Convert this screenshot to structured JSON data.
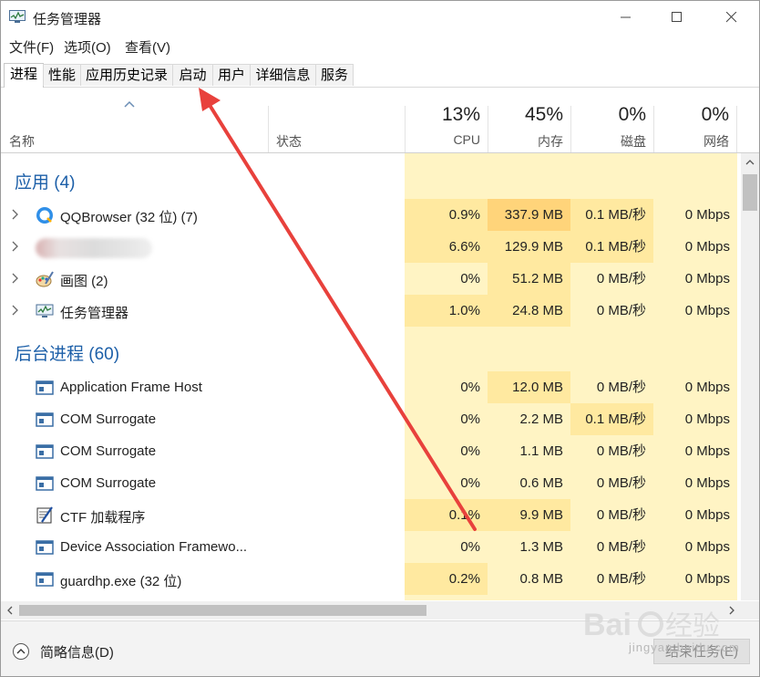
{
  "window": {
    "title": "任务管理器",
    "controls": [
      "minimize-icon",
      "maximize-icon",
      "close-icon"
    ]
  },
  "menu": [
    "文件(F)",
    "选项(O)",
    "查看(V)"
  ],
  "tabs": [
    "进程",
    "性能",
    "应用历史记录",
    "启动",
    "用户",
    "详细信息",
    "服务"
  ],
  "active_tab": "进程",
  "columns": {
    "name": "名称",
    "status": "状态",
    "cpu": {
      "percent": "13%",
      "label": "CPU"
    },
    "memory": {
      "percent": "45%",
      "label": "内存"
    },
    "disk": {
      "percent": "0%",
      "label": "磁盘"
    },
    "network": {
      "percent": "0%",
      "label": "网络"
    }
  },
  "groups": {
    "apps": {
      "title": "应用 (4)",
      "rows": [
        {
          "name": "QQBrowser (32 位) (7)",
          "icon": "qqbrowser-icon",
          "cpu": "0.9%",
          "mem": "337.9 MB",
          "disk": "0.1 MB/秒",
          "net": "0 Mbps"
        },
        {
          "name": "",
          "icon": "blurred-app-icon",
          "cpu": "6.6%",
          "mem": "129.9 MB",
          "disk": "0.1 MB/秒",
          "net": "0 Mbps"
        },
        {
          "name": "画图 (2)",
          "icon": "paint-icon",
          "cpu": "0%",
          "mem": "51.2 MB",
          "disk": "0 MB/秒",
          "net": "0 Mbps"
        },
        {
          "name": "任务管理器",
          "icon": "task-manager-icon",
          "cpu": "1.0%",
          "mem": "24.8 MB",
          "disk": "0 MB/秒",
          "net": "0 Mbps"
        }
      ]
    },
    "background": {
      "title": "后台进程 (60)",
      "rows": [
        {
          "name": "Application Frame Host",
          "icon": "process-window-icon",
          "cpu": "0%",
          "mem": "12.0 MB",
          "disk": "0 MB/秒",
          "net": "0 Mbps"
        },
        {
          "name": "COM Surrogate",
          "icon": "process-window-icon",
          "cpu": "0%",
          "mem": "2.2 MB",
          "disk": "0.1 MB/秒",
          "net": "0 Mbps"
        },
        {
          "name": "COM Surrogate",
          "icon": "process-window-icon",
          "cpu": "0%",
          "mem": "1.1 MB",
          "disk": "0 MB/秒",
          "net": "0 Mbps"
        },
        {
          "name": "COM Surrogate",
          "icon": "process-window-icon",
          "cpu": "0%",
          "mem": "0.6 MB",
          "disk": "0 MB/秒",
          "net": "0 Mbps"
        },
        {
          "name": "CTF 加载程序",
          "icon": "ctf-loader-icon",
          "cpu": "0.1%",
          "mem": "9.9 MB",
          "disk": "0 MB/秒",
          "net": "0 Mbps"
        },
        {
          "name": "Device Association Framewo...",
          "icon": "process-window-icon",
          "cpu": "0%",
          "mem": "1.3 MB",
          "disk": "0 MB/秒",
          "net": "0 Mbps"
        },
        {
          "name": "guardhp.exe (32 位)",
          "icon": "process-window-icon",
          "cpu": "0.2%",
          "mem": "0.8 MB",
          "disk": "0 MB/秒",
          "net": "0 Mbps"
        }
      ]
    }
  },
  "footer": {
    "fewer_details": "简略信息(D)",
    "end_task": "结束任务(E)"
  },
  "colors": {
    "heat_light": "#fff4c4",
    "heat_medium": "#ffe9a0",
    "heat_strong": "#ffd47a",
    "group_title": "#1c5fa8",
    "annotation_arrow": "#e8413c"
  },
  "watermark": {
    "brand": "Baidu经验",
    "url": "jingyan.baidu.com"
  }
}
